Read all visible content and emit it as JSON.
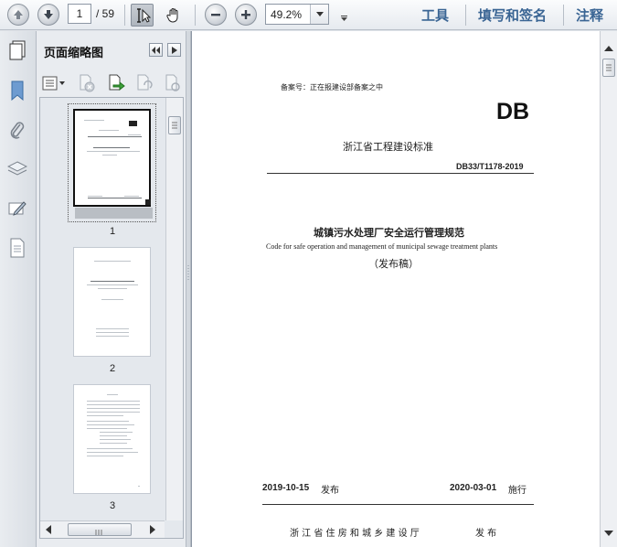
{
  "toolbar": {
    "page_current": "1",
    "page_total": "/ 59",
    "zoom": "49.2%",
    "menu_tools": "工具",
    "menu_fill_sign": "填写和签名",
    "menu_comment": "注释"
  },
  "panel": {
    "title": "页面缩略图",
    "thumbnails": [
      {
        "label": "1"
      },
      {
        "label": "2"
      },
      {
        "label": "3"
      }
    ]
  },
  "document": {
    "record_note": "备案号：正在报建设部备案之中",
    "db_logo": "DB",
    "standard_type": "浙江省工程建设标准",
    "standard_number": "DB33/T1178-2019",
    "title_cn": "城镇污水处理厂安全运行管理规范",
    "title_en": "Code for safe operation and management of municipal sewage treatment plants",
    "release_status": "（发布稿）",
    "issue_date": "2019-10-15",
    "issue_label": "发布",
    "effective_date": "2020-03-01",
    "effective_label": "施行",
    "issuer": "浙 江 省 住 房 和 城 乡 建 设 厅",
    "issuer_label": "发 布"
  }
}
